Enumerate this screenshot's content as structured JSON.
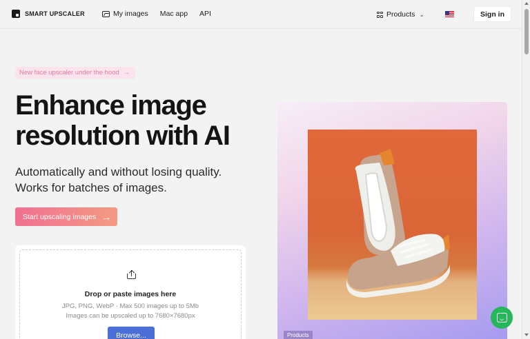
{
  "header": {
    "logo_text": "SMART UPSCALER",
    "nav": [
      {
        "label": "My images",
        "icon": "image-icon"
      },
      {
        "label": "Mac app"
      },
      {
        "label": "API"
      }
    ],
    "products_label": "Products",
    "flag": "us-flag-icon",
    "signin_label": "Sign in"
  },
  "hero": {
    "badge_label": "New face upscaler under the hood",
    "badge_arrow": "→",
    "title_line1": "Enhance image",
    "title_line2": "resolution with AI",
    "subtitle_line1": "Automatically and without losing quality.",
    "subtitle_line2": "Works for batches of images.",
    "cta_label": "Start upscaling images",
    "cta_arrow": "→"
  },
  "upload": {
    "title": "Drop or paste images here",
    "formats_line": "JPG, PNG, WebP · Max 500 images up to 5Mb",
    "resolution_line": "Images can be upscaled up to 7680×7680px",
    "browse_label": "Browse..."
  },
  "showcase": {
    "tag_label": "Products"
  },
  "colors": {
    "accent_blue": "#4b6fd6",
    "cta_gradient_start": "#f07092",
    "cta_gradient_end": "#f49a82",
    "chat_green": "#26b75a",
    "badge_pink": "#e5799f"
  }
}
